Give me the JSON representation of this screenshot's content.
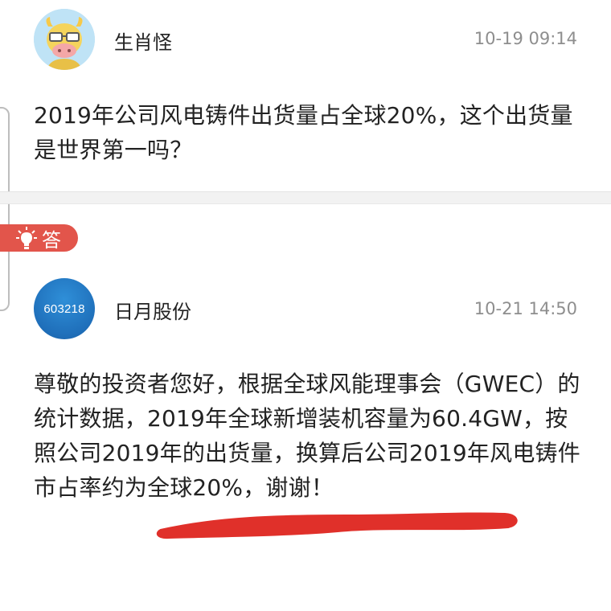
{
  "question": {
    "user_name": "生肖怪",
    "timestamp": "10-19 09:14",
    "text": "2019年公司风电铸件出货量占全球20%，这个出货量是世界第一吗？",
    "avatar_icon": "cartoon-cow-avatar"
  },
  "answer": {
    "badge_label": "答",
    "badge_icon": "lightbulb-icon",
    "badge_color": "#e2554b",
    "user_name": "日月股份",
    "avatar_code": "603218",
    "timestamp": "10-21 14:50",
    "text": "尊敬的投资者您好，根据全球风能理事会（GWEC）的统计数据，2019年全球新增装机容量为60.4GW，按照公司2019年的出货量，换算后公司2019年风电铸件市占率约为全球20%，谢谢！",
    "highlight_color": "#e0302a"
  }
}
